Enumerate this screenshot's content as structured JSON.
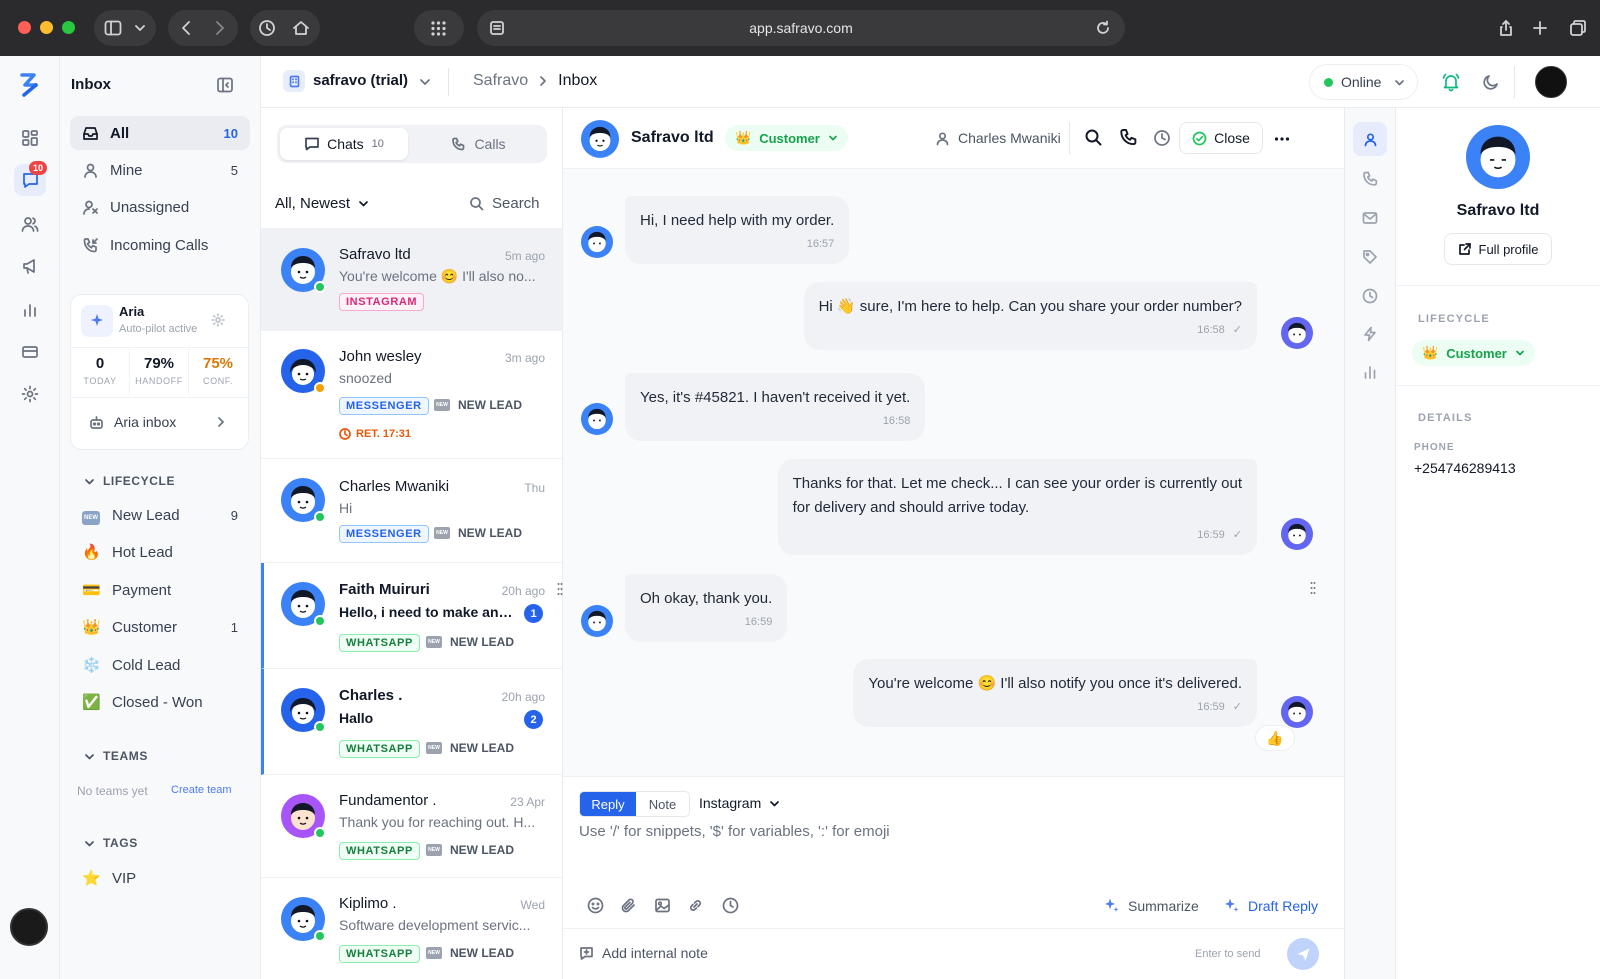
{
  "browser": {
    "url": "app.safravo.com"
  },
  "sidebar": {
    "title": "Inbox",
    "nav": [
      {
        "label": "All",
        "count": "10"
      },
      {
        "label": "Mine",
        "count": "5"
      },
      {
        "label": "Unassigned",
        "count": ""
      },
      {
        "label": "Incoming Calls",
        "count": ""
      }
    ],
    "notif_count": "10",
    "aria": {
      "name": "Aria",
      "status": "Auto-pilot active",
      "stats": [
        {
          "value": "0",
          "label": "TODAY"
        },
        {
          "value": "79%",
          "label": "HANDOFF"
        },
        {
          "value": "75%",
          "label": "CONF."
        }
      ],
      "inbox_label": "Aria inbox"
    },
    "lifecycle_title": "LIFECYCLE",
    "lifecycle": [
      {
        "label": "New Lead",
        "count": "9",
        "icon": "new-badge-icon"
      },
      {
        "label": "Hot Lead",
        "count": "",
        "icon": "🔥"
      },
      {
        "label": "Payment",
        "count": "",
        "icon": "💳"
      },
      {
        "label": "Customer",
        "count": "1",
        "icon": "👑"
      },
      {
        "label": "Cold Lead",
        "count": "",
        "icon": "❄️"
      },
      {
        "label": "Closed - Won",
        "count": "",
        "icon": "✅"
      }
    ],
    "teams_title": "TEAMS",
    "teams_empty": "No teams yet",
    "create_team": "Create team",
    "tags_title": "TAGS",
    "tags": [
      {
        "label": "VIP",
        "icon": "⭐"
      }
    ]
  },
  "workspace": {
    "name": "safravo (trial)",
    "breadcrumb": [
      "Safravo",
      "Inbox"
    ],
    "status": "Online"
  },
  "chatlist": {
    "tabs": [
      {
        "label": "Chats",
        "count": "10"
      },
      {
        "label": "Calls",
        "count": ""
      }
    ],
    "filter": "All, Newest",
    "search": "Search",
    "new_lead": "NEW LEAD",
    "items": [
      {
        "name": "Safravo ltd",
        "time": "5m ago",
        "preview": "You're welcome 😊 I'll also no...",
        "channel": "INSTAGRAM",
        "lead": "",
        "unread": "",
        "extra": ""
      },
      {
        "name": "John wesley",
        "time": "3m ago",
        "preview": "snoozed",
        "channel": "MESSENGER",
        "lead": "NEW LEAD",
        "unread": "",
        "extra": "RET. 17:31"
      },
      {
        "name": "Charles Mwaniki",
        "time": "Thu",
        "preview": "Hi",
        "channel": "MESSENGER",
        "lead": "NEW LEAD",
        "unread": "",
        "extra": ""
      },
      {
        "name": "Faith Muiruri",
        "time": "20h ago",
        "preview": "Hello, i need to make an ...",
        "channel": "WHATSAPP",
        "lead": "NEW LEAD",
        "unread": "1",
        "extra": ""
      },
      {
        "name": "Charles .",
        "time": "20h ago",
        "preview": "Hallo",
        "channel": "WHATSAPP",
        "lead": "NEW LEAD",
        "unread": "2",
        "extra": ""
      },
      {
        "name": "Fundamentor .",
        "time": "23 Apr",
        "preview": "Thank you for reaching out. H...",
        "channel": "WHATSAPP",
        "lead": "NEW LEAD",
        "unread": "",
        "extra": ""
      },
      {
        "name": "Kiplimo .",
        "time": "Wed",
        "preview": "Software development servic...",
        "channel": "WHATSAPP",
        "lead": "NEW LEAD",
        "unread": "",
        "extra": ""
      }
    ]
  },
  "conversation": {
    "contact": "Safravo ltd",
    "lifecycle": "Customer",
    "assignee": "Charles Mwaniki",
    "close_label": "Close",
    "messages": [
      {
        "dir": "in",
        "text": "Hi, I need help with my order.",
        "time": "16:57"
      },
      {
        "dir": "out",
        "text": "Hi 👋 sure, I'm here to help. Can you share your order number?",
        "time": "16:58"
      },
      {
        "dir": "in",
        "text": "Yes, it's #45821. I haven't received it yet.",
        "time": "16:58"
      },
      {
        "dir": "out",
        "text": "Thanks for that. Let me check... I can see your order is currently out",
        "text2": "for delivery and should arrive today.",
        "time": "16:59"
      },
      {
        "dir": "in",
        "text": "Oh okay, thank you.",
        "time": "16:59"
      },
      {
        "dir": "out",
        "text": "You're welcome 😊 I'll also notify you once it's delivered.",
        "time": "16:59",
        "reaction": "👍"
      }
    ],
    "composer": {
      "reply": "Reply",
      "note": "Note",
      "channel": "Instagram",
      "placeholder": "Use '/' for snippets, '$' for variables, ':' for emoji",
      "summarize": "Summarize",
      "draft": "Draft Reply",
      "internal_note": "Add internal note",
      "enter_hint": "Enter to send"
    }
  },
  "profile": {
    "name": "Safravo ltd",
    "full_profile": "Full profile",
    "lifecycle_title": "LIFECYCLE",
    "lifecycle": "Customer",
    "details_title": "DETAILS",
    "phone_label": "PHONE",
    "phone": "+254746289413"
  },
  "colors": {
    "accent": "#2563eb",
    "online": "#22c55e",
    "customer_bg": "#ecfdf3",
    "customer_fg": "#16a34a"
  }
}
